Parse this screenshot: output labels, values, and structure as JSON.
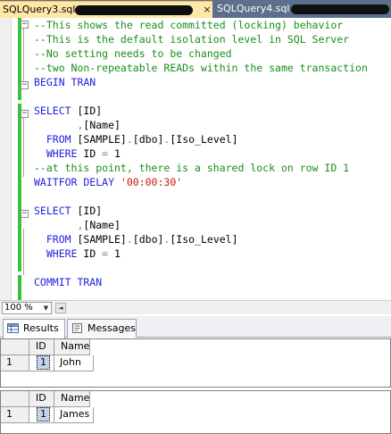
{
  "tabs": [
    {
      "label": "SQLQuery3.sql - ",
      "close": "×",
      "active": true
    },
    {
      "label": "SQLQuery4.sql - ",
      "active": false
    }
  ],
  "editor": {
    "lines": [
      [
        {
          "t": "--This shows the read committed (locking) behavior",
          "c": "cm"
        }
      ],
      [
        {
          "t": "--This is the default isolation level in SQL Server",
          "c": "cm"
        }
      ],
      [
        {
          "t": "--No setting needs to be changed",
          "c": "cm"
        }
      ],
      [
        {
          "t": "--two Non-repeatable READs within the same transaction",
          "c": "cm"
        }
      ],
      [
        {
          "t": "BEGIN TRAN",
          "c": "kw"
        }
      ],
      [],
      [
        {
          "t": "SELECT ",
          "c": "kw"
        },
        {
          "t": "[ID]",
          "c": ""
        }
      ],
      [
        {
          "t": "       ",
          "c": ""
        },
        {
          "t": ",",
          "c": "gr"
        },
        {
          "t": "[Name]",
          "c": ""
        }
      ],
      [
        {
          "t": "  FROM ",
          "c": "kw"
        },
        {
          "t": "[SAMPLE]",
          "c": ""
        },
        {
          "t": ".",
          "c": "gr"
        },
        {
          "t": "[dbo]",
          "c": ""
        },
        {
          "t": ".",
          "c": "gr"
        },
        {
          "t": "[Iso_Level]",
          "c": ""
        }
      ],
      [
        {
          "t": "  WHERE ",
          "c": "kw"
        },
        {
          "t": "ID ",
          "c": ""
        },
        {
          "t": "=",
          "c": "gr"
        },
        {
          "t": " 1",
          "c": ""
        }
      ],
      [
        {
          "t": "--at this point, there is a shared lock on row ID 1",
          "c": "cm"
        }
      ],
      [
        {
          "t": "WAITFOR DELAY ",
          "c": "kw"
        },
        {
          "t": "'00:00:30'",
          "c": "str"
        }
      ],
      [],
      [
        {
          "t": "SELECT ",
          "c": "kw"
        },
        {
          "t": "[ID]",
          "c": ""
        }
      ],
      [
        {
          "t": "       ",
          "c": ""
        },
        {
          "t": ",",
          "c": "gr"
        },
        {
          "t": "[Name]",
          "c": ""
        }
      ],
      [
        {
          "t": "  FROM ",
          "c": "kw"
        },
        {
          "t": "[SAMPLE]",
          "c": ""
        },
        {
          "t": ".",
          "c": "gr"
        },
        {
          "t": "[dbo]",
          "c": ""
        },
        {
          "t": ".",
          "c": "gr"
        },
        {
          "t": "[Iso_Level]",
          "c": ""
        }
      ],
      [
        {
          "t": "  WHERE ",
          "c": "kw"
        },
        {
          "t": "ID ",
          "c": ""
        },
        {
          "t": "=",
          "c": "gr"
        },
        {
          "t": " 1",
          "c": ""
        }
      ],
      [],
      [
        {
          "t": "COMMIT TRAN",
          "c": "kw"
        }
      ]
    ],
    "collapse_marker": "−"
  },
  "zoom": {
    "value": "100 %",
    "arrow": "▼",
    "scroll_left": "◄"
  },
  "results_tabs": {
    "results_label": "Results",
    "messages_label": "Messages"
  },
  "grids": [
    {
      "columns": [
        "ID",
        "Name"
      ],
      "rows": [
        {
          "num": "1",
          "id": "1",
          "name": "John"
        }
      ]
    },
    {
      "columns": [
        "ID",
        "Name"
      ],
      "rows": [
        {
          "num": "1",
          "id": "1",
          "name": "James"
        }
      ]
    }
  ],
  "colors": {
    "active_tab": "#ffe8a6",
    "tab_strip": "#5c6f8c",
    "keyword": "#1f1fe0",
    "comment": "#1a8f1a",
    "string": "#d01010",
    "change_bar": "#3fbf3f"
  }
}
